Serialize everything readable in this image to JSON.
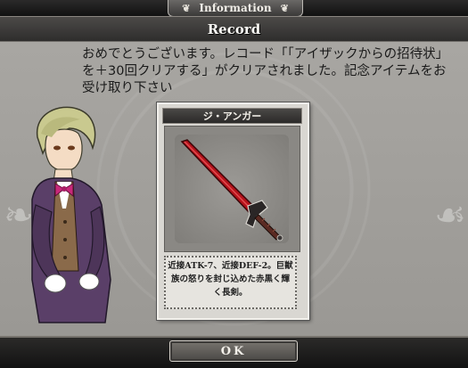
{
  "header": {
    "tab_label": "Information"
  },
  "record": {
    "title": "Record"
  },
  "message": {
    "text": "おめでとうございます。レコード「「アイザックからの招待状」を＋30回クリアする」がクリアされました。記念アイテムをお受け取り下さい"
  },
  "item_card": {
    "name": "ジ・アンガー",
    "description": "近接ATK-7、近接DEF-2。巨獣族の怒りを封じ込めた赤黒く輝く長剣。"
  },
  "footer": {
    "ok_label": "OK"
  },
  "colors": {
    "blade": "#b3121a",
    "hilt": "#5a2a22"
  }
}
